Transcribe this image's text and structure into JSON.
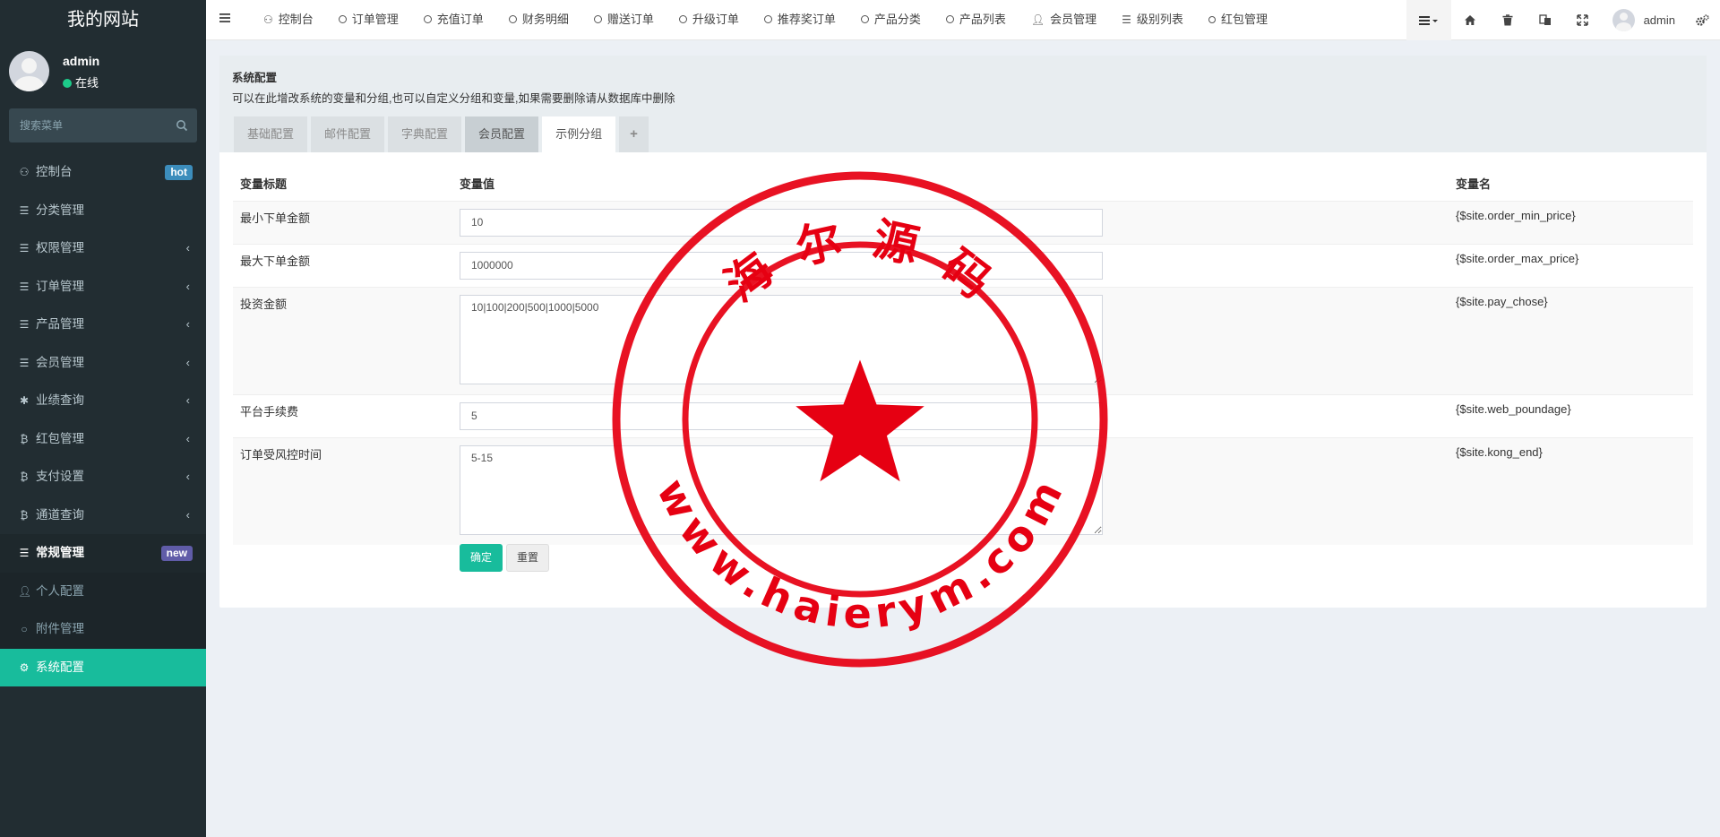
{
  "sidebar": {
    "logo": "我的网站",
    "user": {
      "name": "admin",
      "status": "在线"
    },
    "search_placeholder": "搜索菜单",
    "items": [
      {
        "label": "控制台",
        "badge": "hot"
      },
      {
        "label": "分类管理"
      },
      {
        "label": "权限管理"
      },
      {
        "label": "订单管理"
      },
      {
        "label": "产品管理"
      },
      {
        "label": "会员管理"
      },
      {
        "label": "业绩查询"
      },
      {
        "label": "红包管理"
      },
      {
        "label": "支付设置"
      },
      {
        "label": "通道查询"
      },
      {
        "label": "常规管理",
        "badge": "new"
      },
      {
        "label": "个人配置"
      },
      {
        "label": "附件管理"
      },
      {
        "label": "系统配置"
      }
    ]
  },
  "header": {
    "tabs": [
      "控制台",
      "订单管理",
      "充值订单",
      "财务明细",
      "赠送订单",
      "升级订单",
      "推荐奖订单",
      "产品分类",
      "产品列表",
      "会员管理",
      "级别列表",
      "红包管理"
    ],
    "user": "admin"
  },
  "panel": {
    "title": "系统配置",
    "desc": "可以在此增改系统的变量和分组,也可以自定义分组和变量,如果需要删除请从数据库中删除",
    "tabs": [
      "基础配置",
      "邮件配置",
      "字典配置",
      "会员配置",
      "示例分组",
      "+"
    ]
  },
  "table": {
    "headers": [
      "变量标题",
      "变量值",
      "变量名"
    ],
    "rows": [
      {
        "title": "最小下单金额",
        "value": "10",
        "key": "{$site.order_min_price}"
      },
      {
        "title": "最大下单金额",
        "value": "1000000",
        "key": "{$site.order_max_price}"
      },
      {
        "title": "投资金额",
        "value": "10|100|200|500|1000|5000",
        "key": "{$site.pay_chose}"
      },
      {
        "title": "平台手续费",
        "value": "5",
        "key": "{$site.web_poundage}"
      },
      {
        "title": "订单受风控时间",
        "value": "5-15",
        "key": "{$site.kong_end}"
      }
    ]
  },
  "buttons": {
    "ok": "确定",
    "reset": "重置"
  },
  "watermark": {
    "text_top": "海 尔 源 码",
    "text_bottom": "www.haierym.com"
  },
  "colors": {
    "accent": "#18bc9c",
    "sidebar": "#222d32",
    "stamp": "#e60012"
  }
}
